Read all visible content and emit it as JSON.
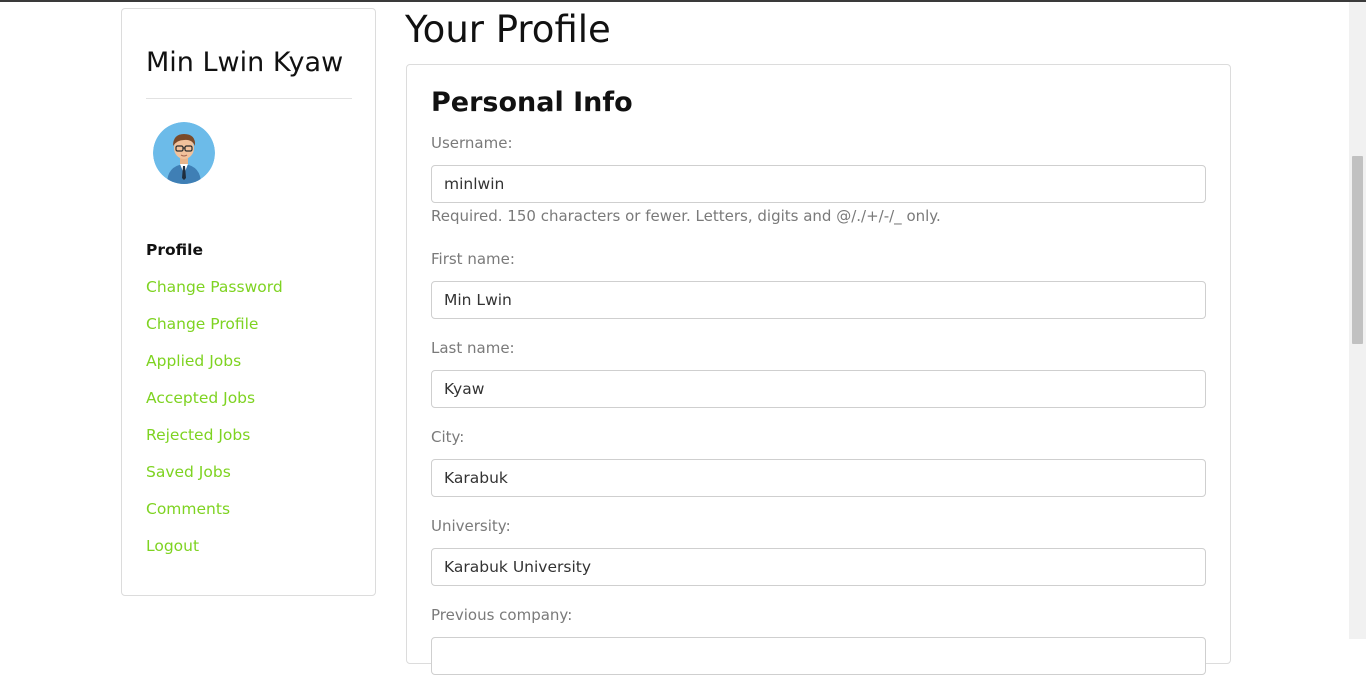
{
  "sidebar": {
    "user_name": "Min Lwin Kyaw",
    "nav": [
      {
        "label": "Profile",
        "active": true
      },
      {
        "label": "Change Password",
        "active": false
      },
      {
        "label": "Change Profile",
        "active": false
      },
      {
        "label": "Applied Jobs",
        "active": false
      },
      {
        "label": "Accepted Jobs",
        "active": false
      },
      {
        "label": "Rejected Jobs",
        "active": false
      },
      {
        "label": "Saved Jobs",
        "active": false
      },
      {
        "label": "Comments",
        "active": false
      },
      {
        "label": "Logout",
        "active": false
      }
    ],
    "link_color": "#7ed321"
  },
  "main": {
    "title": "Your Profile",
    "card_title": "Personal Info",
    "fields": {
      "username": {
        "label": "Username:",
        "value": "minlwin",
        "help": "Required. 150 characters or fewer. Letters, digits and @/./+/-/_ only."
      },
      "first_name": {
        "label": "First name:",
        "value": "Min Lwin"
      },
      "last_name": {
        "label": "Last name:",
        "value": "Kyaw"
      },
      "city": {
        "label": "City:",
        "value": "Karabuk"
      },
      "university": {
        "label": "University:",
        "value": "Karabuk University"
      },
      "previous_company": {
        "label": "Previous company:",
        "value": ""
      }
    }
  }
}
